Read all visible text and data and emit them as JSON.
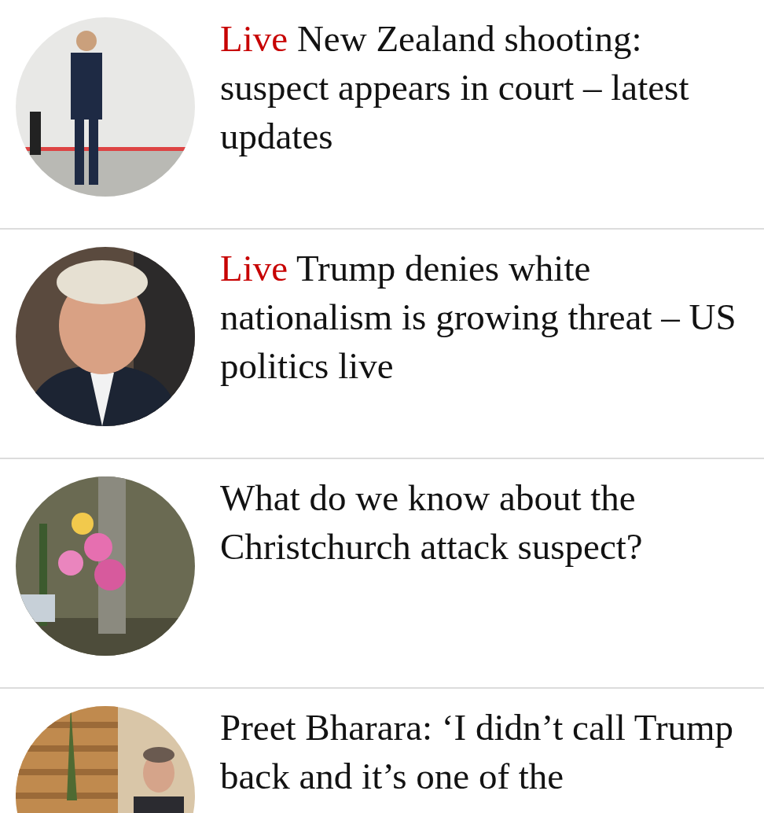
{
  "articles": [
    {
      "kicker": "Live",
      "headline": "New Zealand shooting: suspect appears in court – latest updates"
    },
    {
      "kicker": "Live",
      "headline": "Trump denies white nationalism is growing threat – US politics live"
    },
    {
      "headline": "What do we know about the Christchurch attack suspect?"
    },
    {
      "headline": "Preet Bharara: ‘I didn’t call Trump back and it’s one of the"
    }
  ]
}
